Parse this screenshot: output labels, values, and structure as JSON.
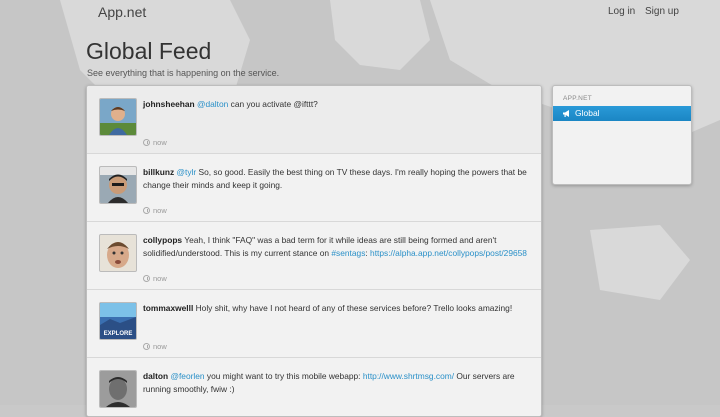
{
  "navbar": {
    "brand": "App.net",
    "login": "Log in",
    "signup": "Sign up"
  },
  "page": {
    "title": "Global Feed",
    "subtitle": "See everything that is happening on the service."
  },
  "posts": [
    {
      "username": "johnsheehan",
      "segments": [
        {
          "text": "@dalton",
          "link": true
        },
        {
          "text": " can you activate @ifttt?",
          "link": false
        }
      ],
      "time": "now",
      "avatar": "avatar-johnsheehan"
    },
    {
      "username": "billkunz",
      "segments": [
        {
          "text": "@tylr",
          "link": true
        },
        {
          "text": " So, so good. Easily the best thing on TV these days. I'm really hoping the powers that be change their minds and keep it going.",
          "link": false
        }
      ],
      "time": "now",
      "avatar": "avatar-billkunz"
    },
    {
      "username": "collypops",
      "segments": [
        {
          "text": " Yeah, I think \"FAQ\" was a bad term for it while ideas are still being formed and aren't solidified/understood. This is my current stance on ",
          "link": false
        },
        {
          "text": "#sentags",
          "link": true
        },
        {
          "text": ": ",
          "link": false
        },
        {
          "text": "https://alpha.app.net/collypops/post/29658",
          "link": true
        }
      ],
      "time": "now",
      "avatar": "avatar-collypops"
    },
    {
      "username": "tommaxwelll",
      "segments": [
        {
          "text": " Holy shit, why have I not heard of any of these services before? Trello looks amazing!",
          "link": false
        }
      ],
      "time": "now",
      "avatar": "avatar-tommaxwelll",
      "avatar_text": "EXPLORE"
    },
    {
      "username": "dalton",
      "segments": [
        {
          "text": "@feorlen",
          "link": true
        },
        {
          "text": " you might want to try this mobile webapp: ",
          "link": false
        },
        {
          "text": "http://www.shrtmsg.com/",
          "link": true
        },
        {
          "text": " Our servers are running smoothly, fwiw :)",
          "link": false
        }
      ],
      "time": "",
      "avatar": "avatar-dalton"
    }
  ],
  "sidebar": {
    "heading": "APP.NET",
    "item_label": "Global",
    "item_icon": "megaphone-icon"
  },
  "colors": {
    "accent": "#2a90c8",
    "active_item": "#1e8ccb",
    "background": "#c9c9c9"
  }
}
